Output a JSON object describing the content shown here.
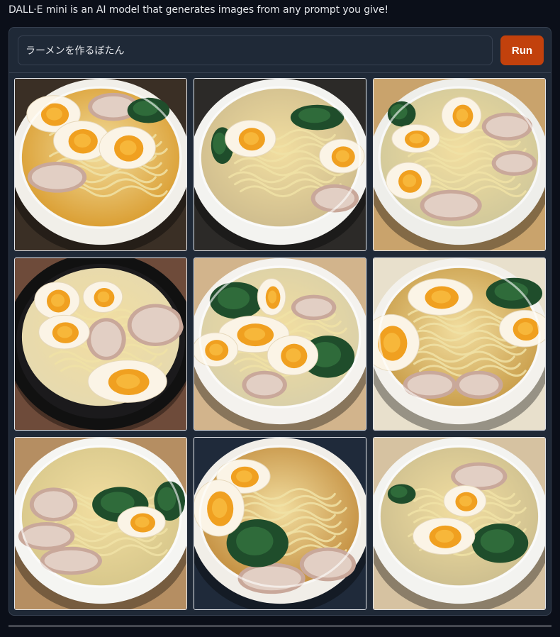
{
  "app": {
    "description": "DALL·E mini is an AI model that generates images from any prompt you give!"
  },
  "prompt": {
    "value": "ラーメンを作るぼたん"
  },
  "run_button": {
    "label": "Run"
  },
  "colors": {
    "background": "#0b0f19",
    "panel": "#1f2937",
    "accent": "#c2410c"
  },
  "gallery": {
    "images": [
      {
        "name": "generated-image-1",
        "subject": "ramen bowl with soft-boiled eggs"
      },
      {
        "name": "generated-image-2",
        "subject": "ramen bowl with soft-boiled eggs"
      },
      {
        "name": "generated-image-3",
        "subject": "ramen bowl with soft-boiled eggs"
      },
      {
        "name": "generated-image-4",
        "subject": "ramen bowl with soft-boiled eggs"
      },
      {
        "name": "generated-image-5",
        "subject": "ramen bowl with soft-boiled eggs"
      },
      {
        "name": "generated-image-6",
        "subject": "ramen bowl with soft-boiled eggs"
      },
      {
        "name": "generated-image-7",
        "subject": "ramen bowl with soft-boiled eggs"
      },
      {
        "name": "generated-image-8",
        "subject": "ramen bowl with soft-boiled eggs"
      },
      {
        "name": "generated-image-9",
        "subject": "ramen bowl with soft-boiled eggs"
      }
    ]
  }
}
